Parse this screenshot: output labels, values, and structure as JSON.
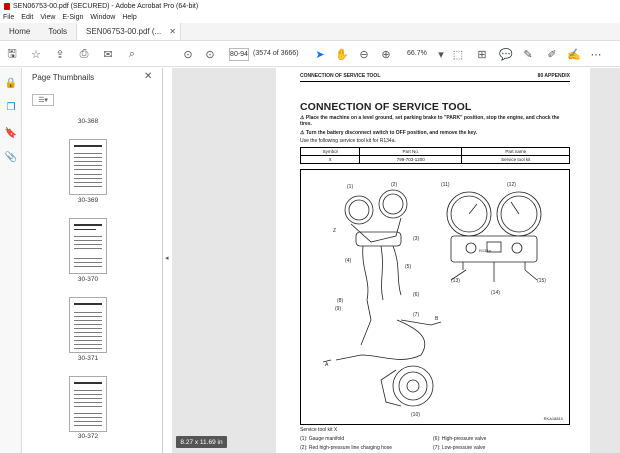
{
  "window": {
    "title": "SEN06753-00.pdf (SECURED) - Adobe Acrobat Pro (64-bit)"
  },
  "menu": [
    "File",
    "Edit",
    "View",
    "E-Sign",
    "Window",
    "Help"
  ],
  "tabs": {
    "home": "Home",
    "tools": "Tools",
    "document": "SEN06753-00.pdf (..."
  },
  "toolbar": {
    "page_input": "80-94",
    "page_count": "(3574 of 3666)",
    "zoom": "66.7%"
  },
  "panel": {
    "title": "Page Thumbnails",
    "thumbnails": [
      "30-368",
      "30-369",
      "30-370",
      "30-371",
      "30-372"
    ]
  },
  "page_size": "8.27 x 11.69 in",
  "document": {
    "header_left": "CONNECTION OF SERVICE TOOL",
    "header_right": "80 APPENDIX",
    "title": "CONNECTION OF SERVICE TOOL",
    "warning1": "Place the machine on a level ground, set parking brake to \"PARK\" position, stop the engine, and chock the tires.",
    "warning2": "Turn the battery disconnect switch to OFF position, and remove the key.",
    "note": "Use the following service tool kit for R134a.",
    "table": {
      "headers": [
        "Symbol",
        "Part No.",
        "Part name"
      ],
      "rows": [
        [
          "X",
          "799-703-1200",
          "Service tool kit"
        ]
      ]
    },
    "figure_code": "RKA18810",
    "caption_title": "Service tool kit X",
    "captions_left": [
      "(1): Gauge manifold",
      "(2): Red high-pressure line charging hose"
    ],
    "captions_right": [
      "(6): High-pressure valve",
      "(7): Low-pressure valve"
    ]
  },
  "colors": {
    "accent": "#1473e6",
    "background": "#e6e6e6"
  }
}
